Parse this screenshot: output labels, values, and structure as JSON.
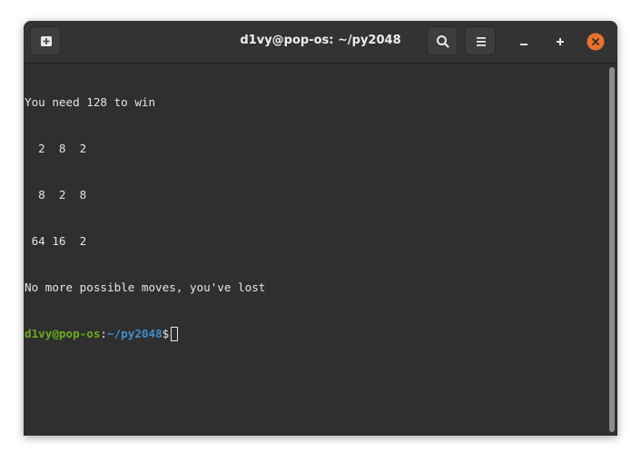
{
  "window": {
    "title": "d1vy@pop-os: ~/py2048"
  },
  "header": {
    "new_tab_icon": "new-tab-icon",
    "search_icon": "search-icon",
    "menu_icon": "hamburger-menu-icon",
    "minimize_icon": "minimize-icon",
    "maximize_icon": "maximize-icon",
    "close_icon": "close-icon",
    "close_color": "#e8722b"
  },
  "terminal": {
    "lines": [
      "You need 128 to win",
      "  2  8  2",
      "  8  2  8",
      " 64 16  2",
      "No more possible moves, you've lost"
    ],
    "prompt": {
      "user_host": "d1vy@pop-os",
      "sep": ":",
      "path": "~/py2048",
      "symbol": "$"
    }
  },
  "colors": {
    "background": "#2f2f2f",
    "text": "#e6e6e6",
    "prompt_user": "#6aab1c",
    "prompt_path": "#3e8fd0"
  }
}
